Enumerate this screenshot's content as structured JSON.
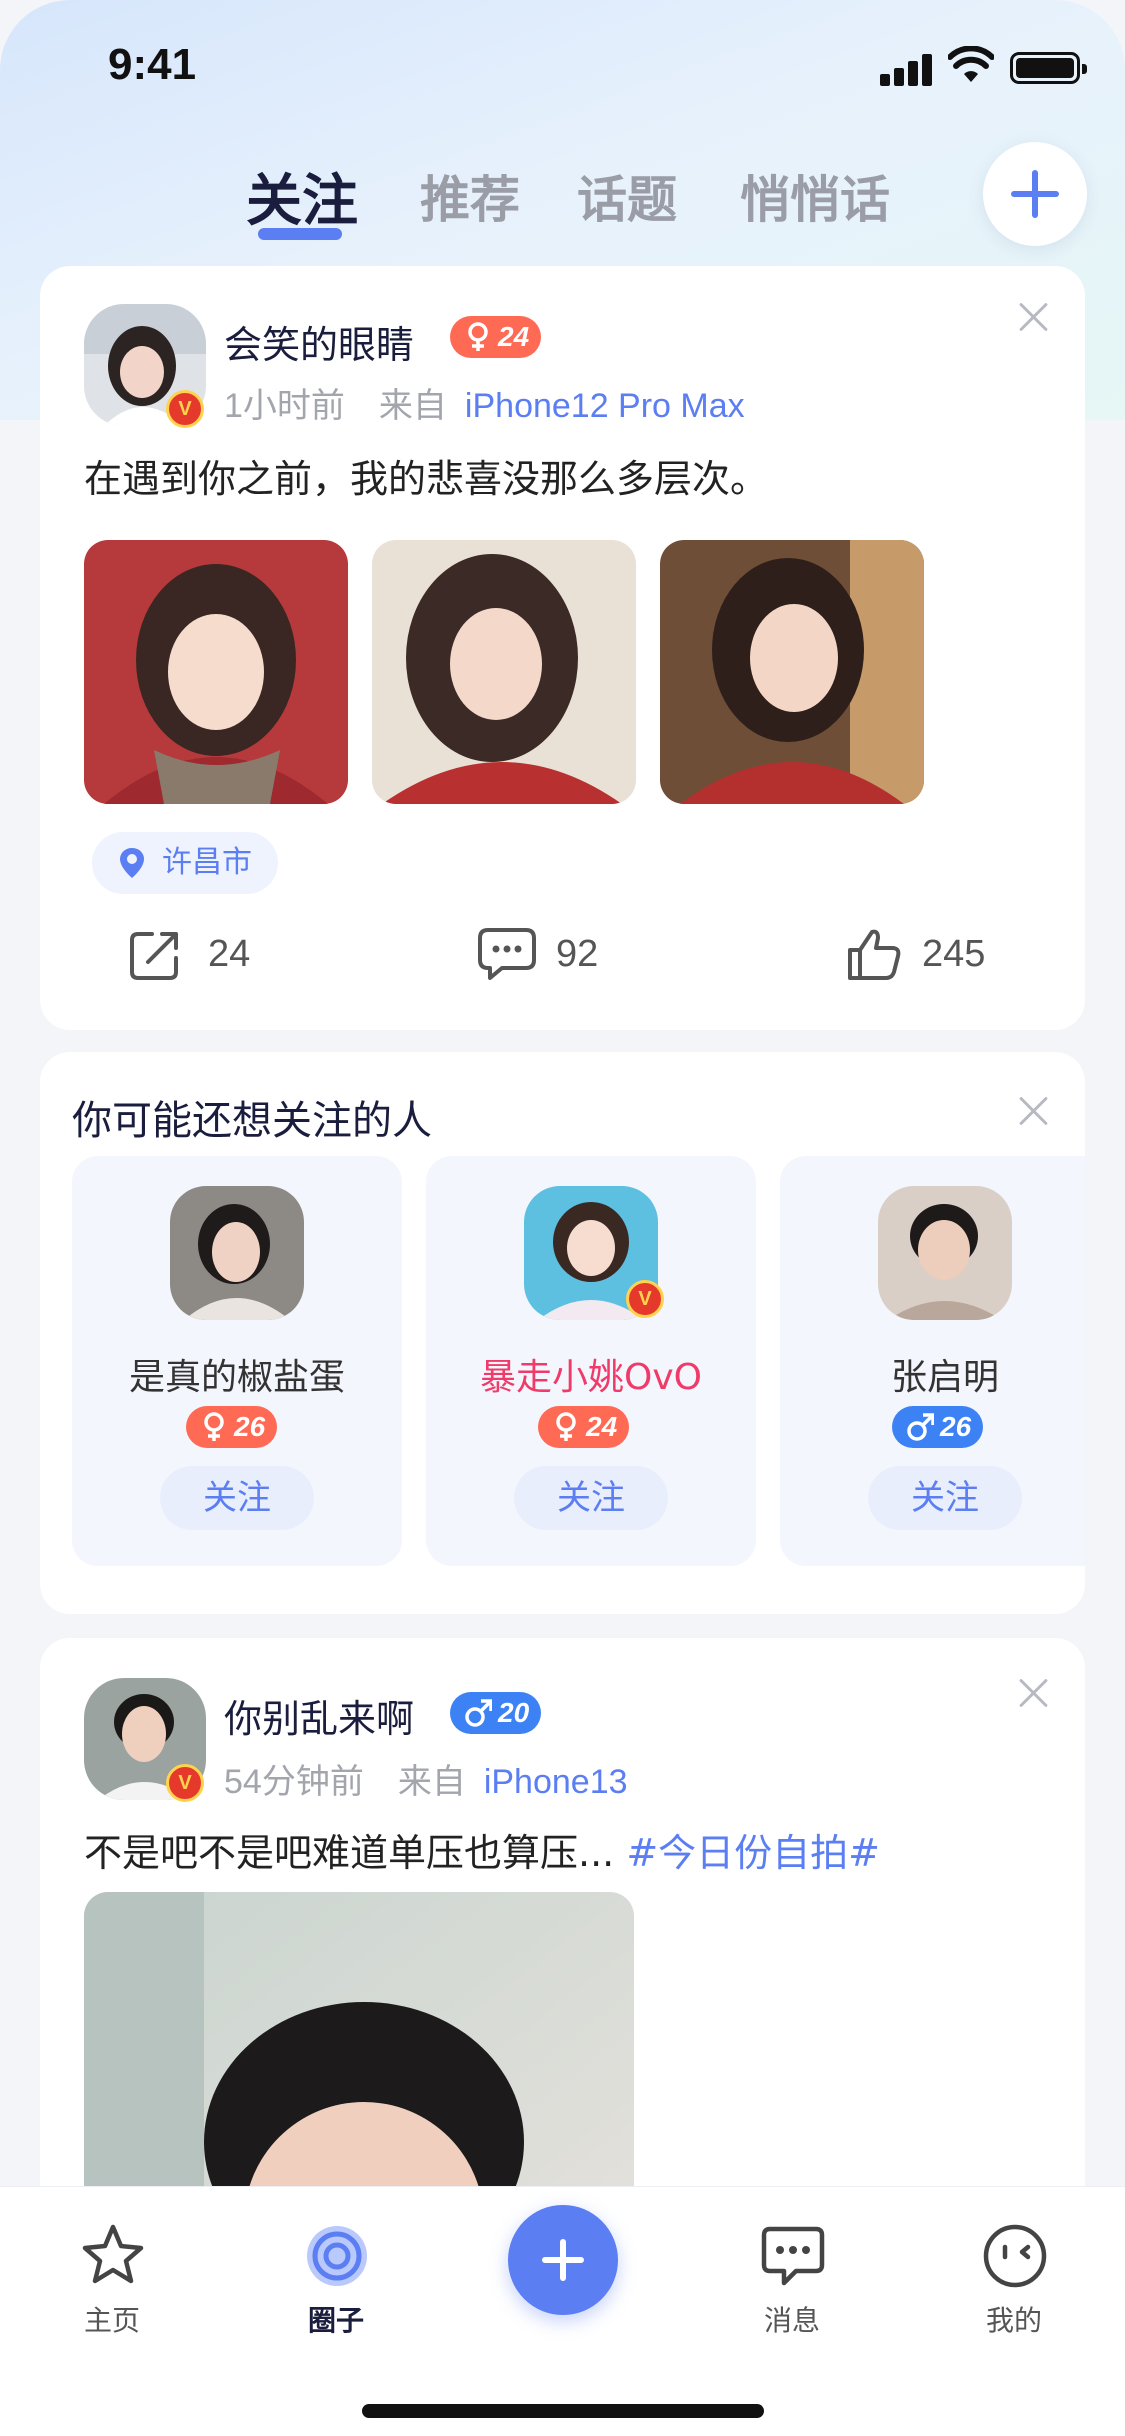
{
  "status_bar": {
    "time": "9:41"
  },
  "top_tabs": [
    {
      "label": "关注",
      "active": true
    },
    {
      "label": "推荐",
      "active": false
    },
    {
      "label": "话题",
      "active": false
    },
    {
      "label": "悄悄话",
      "active": false
    }
  ],
  "post1": {
    "username": "会笑的眼睛",
    "gender": "female",
    "age": "24",
    "verified_badge": "V",
    "time": "1小时前",
    "from_label": "来自",
    "device": "iPhone12 Pro Max",
    "text": "在遇到你之前，我的悲喜没那么多层次。",
    "location": "许昌市",
    "share_count": "24",
    "comment_count": "92",
    "like_count": "245"
  },
  "suggest": {
    "title": "你可能还想关注的人",
    "users": [
      {
        "name": "是真的椒盐蛋",
        "gender": "female",
        "age": "26",
        "follow_label": "关注"
      },
      {
        "name": "暴走小姚OvO",
        "gender": "female",
        "age": "24",
        "follow_label": "关注",
        "verified_badge": "V"
      },
      {
        "name": "张启明",
        "gender": "male",
        "age": "26",
        "follow_label": "关注"
      }
    ]
  },
  "post2": {
    "username": "你别乱来啊",
    "gender": "male",
    "age": "20",
    "verified_badge": "V",
    "time": "54分钟前",
    "from_label": "来自",
    "device": "iPhone13",
    "text": "不是吧不是吧难道单压也算压...",
    "hashtag": "#今日份自拍#"
  },
  "bottom_nav": [
    {
      "label": "主页",
      "icon": "star-icon",
      "active": false
    },
    {
      "label": "圈子",
      "icon": "circle-icon",
      "active": true
    },
    {
      "label": "",
      "icon": "plus-icon",
      "active": false
    },
    {
      "label": "消息",
      "icon": "chat-icon",
      "active": false
    },
    {
      "label": "我的",
      "icon": "face-icon",
      "active": false
    }
  ],
  "colors": {
    "accent": "#5b7ef2",
    "female_badge": "#ff6a55",
    "male_badge": "#3d82f5",
    "pink_name": "#f03a69"
  }
}
